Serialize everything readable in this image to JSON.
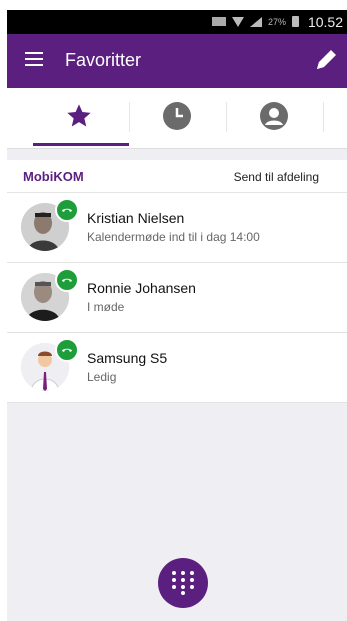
{
  "status_bar": {
    "battery_percent": "27%",
    "time": "10.52"
  },
  "app_bar": {
    "title": "Favoritter",
    "menu_icon": "hamburger-menu-icon",
    "edit_icon": "pencil-icon"
  },
  "tabs": [
    {
      "icon": "star-icon",
      "selected": true
    },
    {
      "icon": "clock-icon",
      "selected": false
    },
    {
      "icon": "person-icon",
      "selected": false
    }
  ],
  "section": {
    "title": "MobiKOM",
    "action": "Send til afdeling"
  },
  "contacts": [
    {
      "name": "Kristian Nielsen",
      "status": "Kalendermøde ind til i dag 14:00",
      "presence_icon": "phone-icon"
    },
    {
      "name": "Ronnie Johansen",
      "status": "I møde",
      "presence_icon": "phone-icon"
    },
    {
      "name": "Samsung S5",
      "status": "Ledig",
      "presence_icon": "phone-icon"
    }
  ],
  "colors": {
    "brand": "#5b1f80",
    "presence": "#1d9e3a"
  },
  "fab": {
    "icon": "dialpad-icon"
  }
}
